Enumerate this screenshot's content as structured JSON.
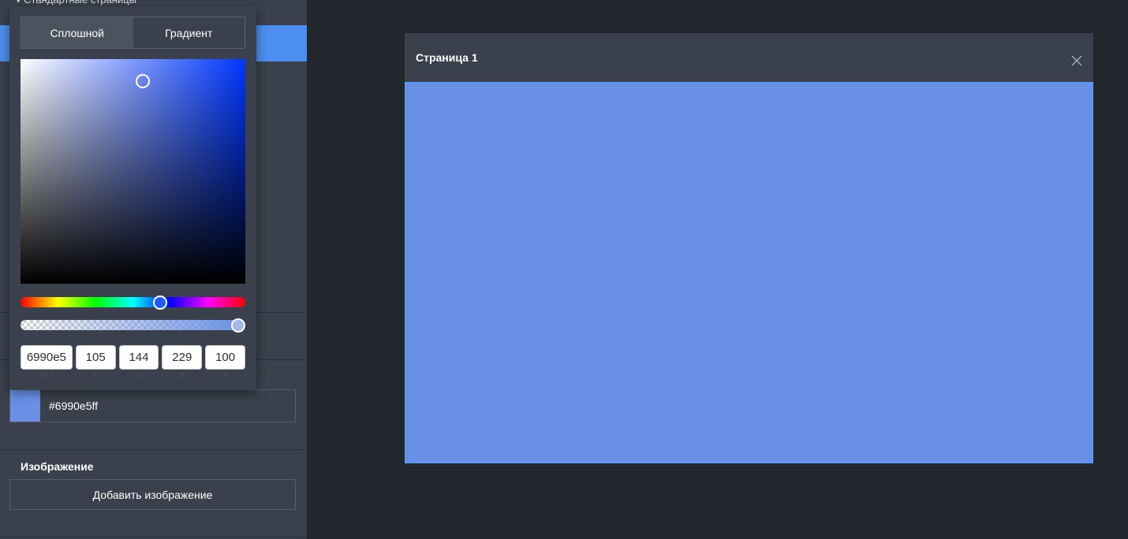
{
  "sidebar": {
    "section_heading": "▾ Стандартные страницы",
    "fill_color_value": "#6990e5ff",
    "image_section_title": "Изображение",
    "add_image_label": "Добавить изображение"
  },
  "picker": {
    "tabs": [
      {
        "label": "Сплошной",
        "active": true
      },
      {
        "label": "Градиент",
        "active": false
      }
    ],
    "hue_color": "#0036ff",
    "selected_color": "#6990e5",
    "alpha_level": 1.0,
    "fields": [
      {
        "value": "6990e5",
        "caption": "HEX"
      },
      {
        "value": "105",
        "caption": "R"
      },
      {
        "value": "144",
        "caption": "G"
      },
      {
        "value": "229",
        "caption": "B"
      },
      {
        "value": "100",
        "caption": "A"
      }
    ]
  },
  "preview": {
    "title": "Страница 1",
    "close_icon": "close-icon",
    "background_color": "#6990e5"
  },
  "colors": {
    "accent": "#4d8ff0",
    "panel": "#3a414c",
    "canvas_bg": "#22262d"
  }
}
